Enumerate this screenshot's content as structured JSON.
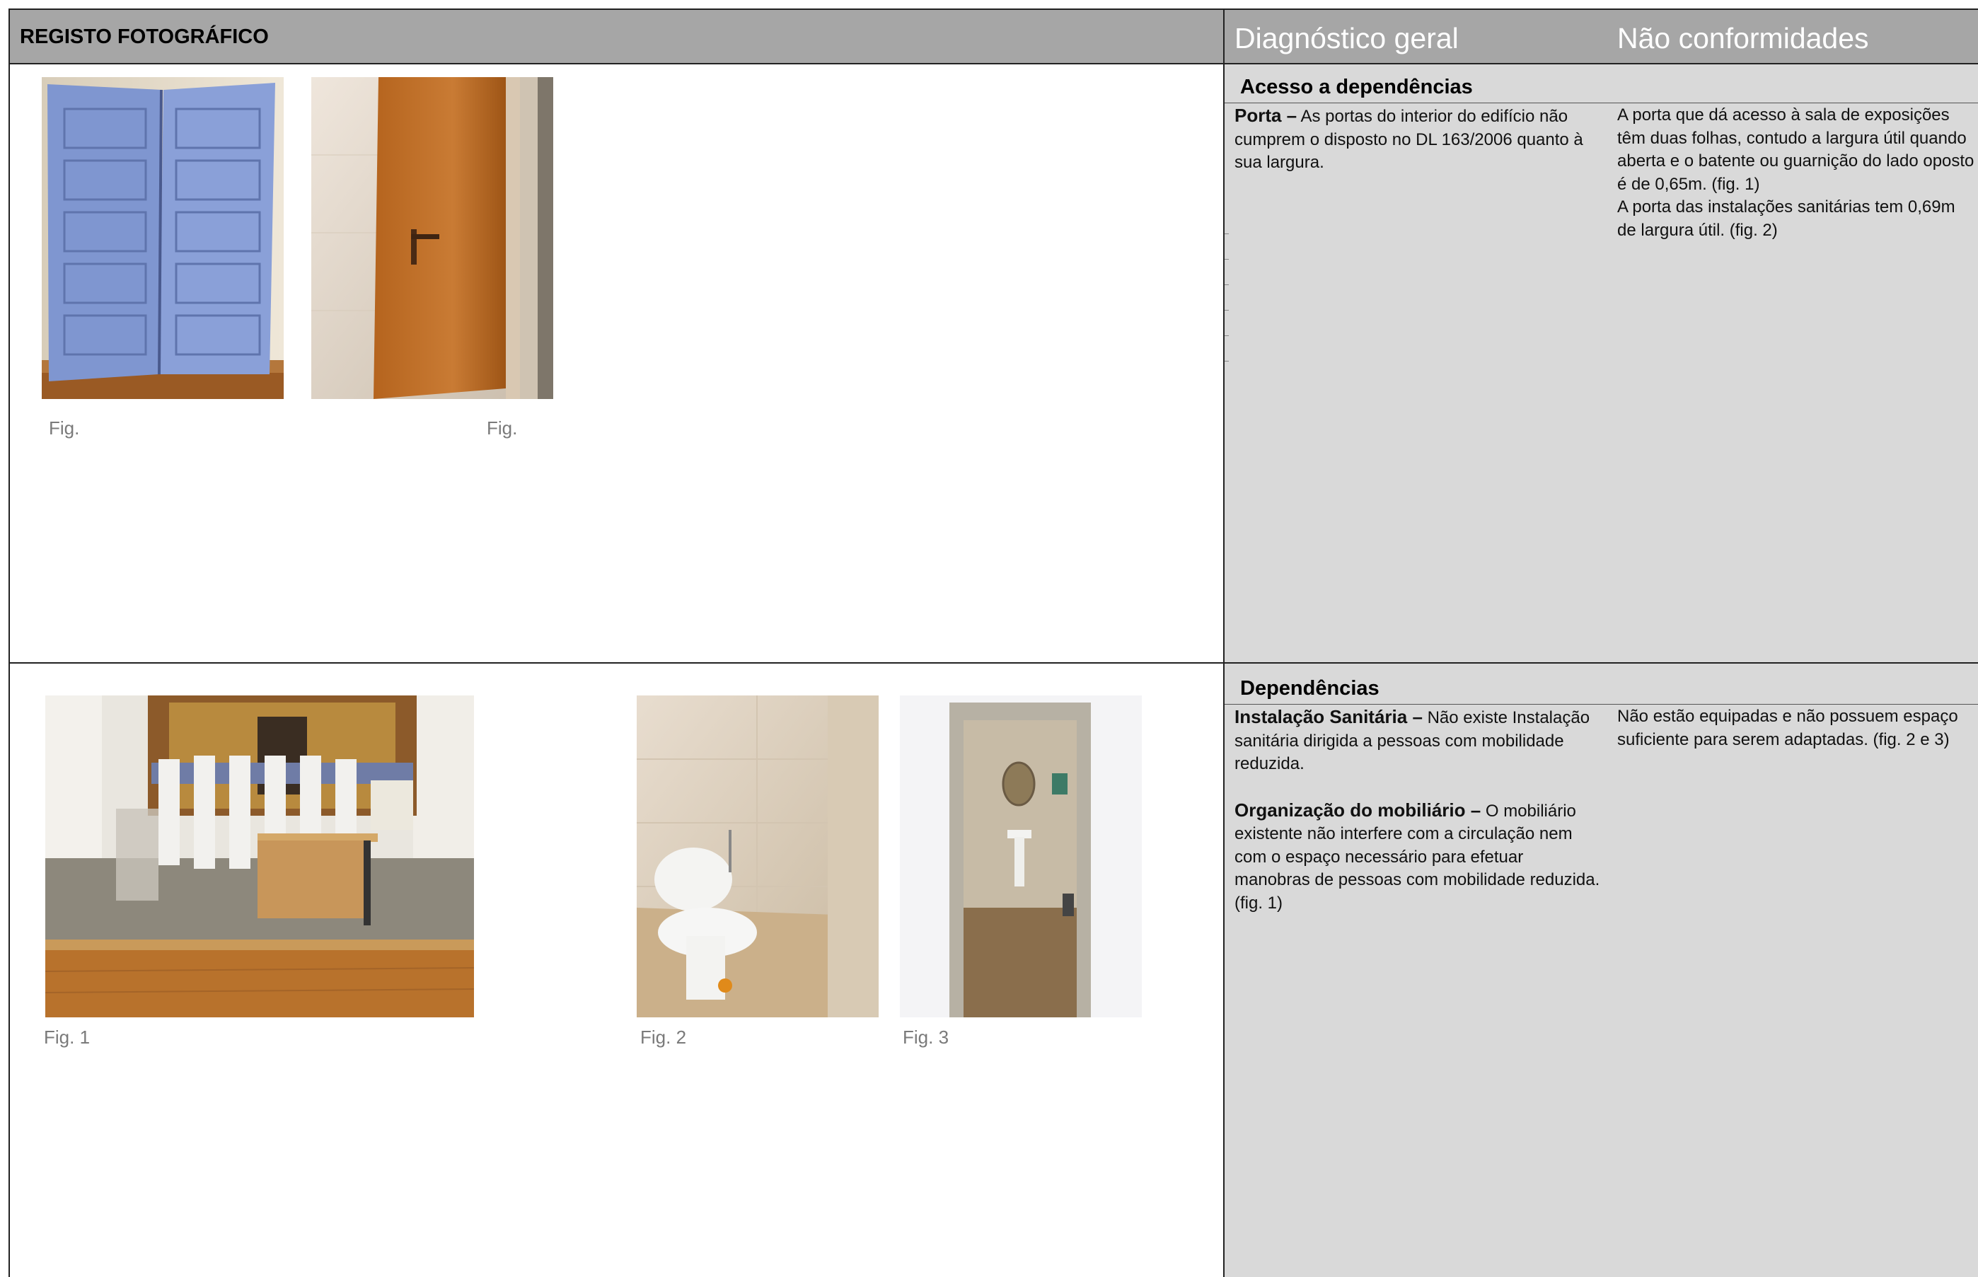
{
  "header": {
    "left_title": "REGISTO FOTOGRÁFICO",
    "diag_title": "Diagnóstico geral",
    "nc_title": "Não conformidades"
  },
  "section1": {
    "title": "Acesso a dependências",
    "diag_bold": "Porta –",
    "diag_text": "As portas do interior do edifício não cumprem o disposto no DL 163/2006 quanto à sua largura.",
    "nc_lines": [
      "A porta que dá acesso à sala de exposições têm duas folhas, contudo a largura útil quando aberta e o batente ou guarnição do lado oposto é de 0,65m. (fig. 1)",
      "A porta das instalações sanitárias tem 0,69m de largura útil. (fig. 2)"
    ],
    "captions": [
      "Fig.",
      "Fig."
    ]
  },
  "section2": {
    "title": "Dependências",
    "diag1_bold": "Instalação Sanitária –",
    "diag1_text": "Não existe Instalação sanitária dirigida a pessoas com mobilidade reduzida.",
    "diag2_bold": "Organização do mobiliário –",
    "diag2_text": "O mobiliário existente não interfere com a circulação nem com o espaço necessário para efetuar manobras de pessoas com mobilidade reduzida. (fig. 1)",
    "nc_text": "Não estão equipadas e não possuem espaço suficiente para serem adaptadas. (fig. 2 e 3)",
    "captions": [
      "Fig. 1",
      "Fig. 2",
      "Fig. 3"
    ]
  },
  "colors": {
    "header_bg": "#a6a6a6",
    "panel_bg": "#d9d9d9",
    "door_blue": "#7f96d0",
    "door_wood": "#b86a24"
  }
}
